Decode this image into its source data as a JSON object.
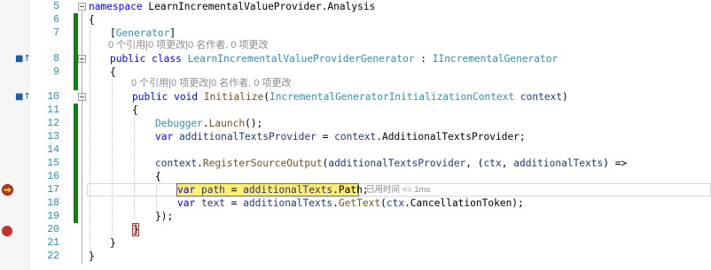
{
  "editor": {
    "lines": [
      {
        "num": "5"
      },
      {
        "num": "6"
      },
      {
        "num": "7"
      },
      {
        "num": "8"
      },
      {
        "num": "9"
      },
      {
        "num": "10"
      },
      {
        "num": "11"
      },
      {
        "num": "12"
      },
      {
        "num": "13"
      },
      {
        "num": "14"
      },
      {
        "num": "15"
      },
      {
        "num": "16"
      },
      {
        "num": "17"
      },
      {
        "num": "18"
      },
      {
        "num": "19"
      },
      {
        "num": "20"
      },
      {
        "num": "21"
      },
      {
        "num": "22"
      }
    ],
    "code": {
      "l5": [
        "namespace",
        " LearnIncrementalValueProvider.Analysis"
      ],
      "l6": "{",
      "l7": [
        "[",
        "Generator",
        "]"
      ],
      "lens1": "0 个引用|0 项更改|0 名作者, 0 项更改",
      "l8": [
        "public",
        " ",
        "class",
        " ",
        "LearnIncrementalValueProviderGenerator",
        " : ",
        "IIncrementalGenerator"
      ],
      "l9": "{",
      "lens2": "0 个引用|0 项更改|0 名作者, 0 项更改",
      "l10": [
        "public",
        " ",
        "void",
        " ",
        "Initialize",
        "(",
        "IncrementalGeneratorInitializationContext",
        " ",
        "context",
        ")"
      ],
      "l11": "{",
      "l12": [
        "Debugger",
        ".",
        "Launch",
        "();"
      ],
      "l13": [
        "var",
        " ",
        "additionalTextsProvider",
        " = ",
        "context",
        ".AdditionalTextsProvider;"
      ],
      "l14": "",
      "l15": [
        "context",
        ".",
        "RegisterSourceOutput",
        "(",
        "additionalTextsProvider",
        ", (",
        "ctx",
        ", ",
        "additionalTexts",
        ") =>"
      ],
      "l16": "{",
      "l17": [
        "var",
        " ",
        "path",
        " = ",
        "additionalTexts",
        ".Path;"
      ],
      "l17_tip": "已用时间 <= 1ms",
      "l18": [
        "var",
        " ",
        "text",
        " = ",
        "additionalTexts",
        ".",
        "GetText",
        "(",
        "ctx",
        ".CancellationToken);"
      ],
      "l19": "});",
      "l20": "}",
      "l21": "}",
      "l22": "}"
    },
    "colors": {
      "keyword": "#0000ff",
      "type": "#2b91af",
      "method": "#74531f",
      "parameter": "#1f377f",
      "line_number": "#2b91af",
      "change_bar": "#108010",
      "breakpoint": "#c5312e",
      "exec_highlight": "#ffef6c"
    },
    "icons": [
      "implementation-marker-icon",
      "breakpoint-icon",
      "current-statement-arrow-icon",
      "collapse-icon"
    ]
  }
}
